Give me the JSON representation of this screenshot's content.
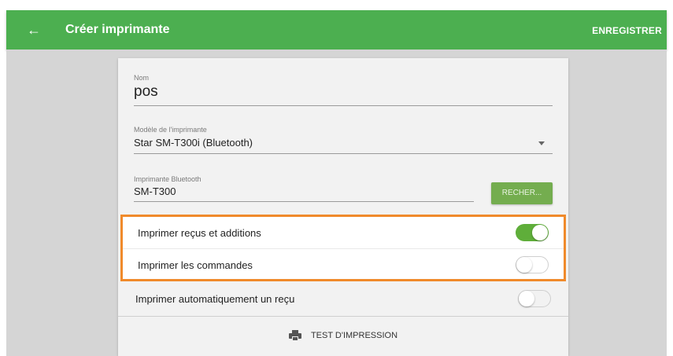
{
  "appbar": {
    "title": "Créer imprimante",
    "save_label": "ENREGISTRER",
    "back_icon": "←",
    "color": "#4caf50"
  },
  "form": {
    "name": {
      "label": "Nom",
      "value": "pos"
    },
    "model": {
      "label": "Modèle de l'imprimante",
      "value": "Star SM-T300i (Bluetooth)"
    },
    "bluetooth": {
      "label": "Imprimante Bluetooth",
      "value": "SM-T300",
      "scan_label": "RECHER..."
    }
  },
  "toggles": [
    {
      "label": "Imprimer reçus et additions",
      "on": true
    },
    {
      "label": "Imprimer les commandes",
      "on": false
    },
    {
      "label": "Imprimer automatiquement un reçu",
      "on": false
    }
  ],
  "test_print": {
    "label": "TEST D'IMPRESSION",
    "icon": "printer-icon"
  },
  "colors": {
    "accent": "#5fae3a",
    "highlight": "#f08a2b"
  }
}
